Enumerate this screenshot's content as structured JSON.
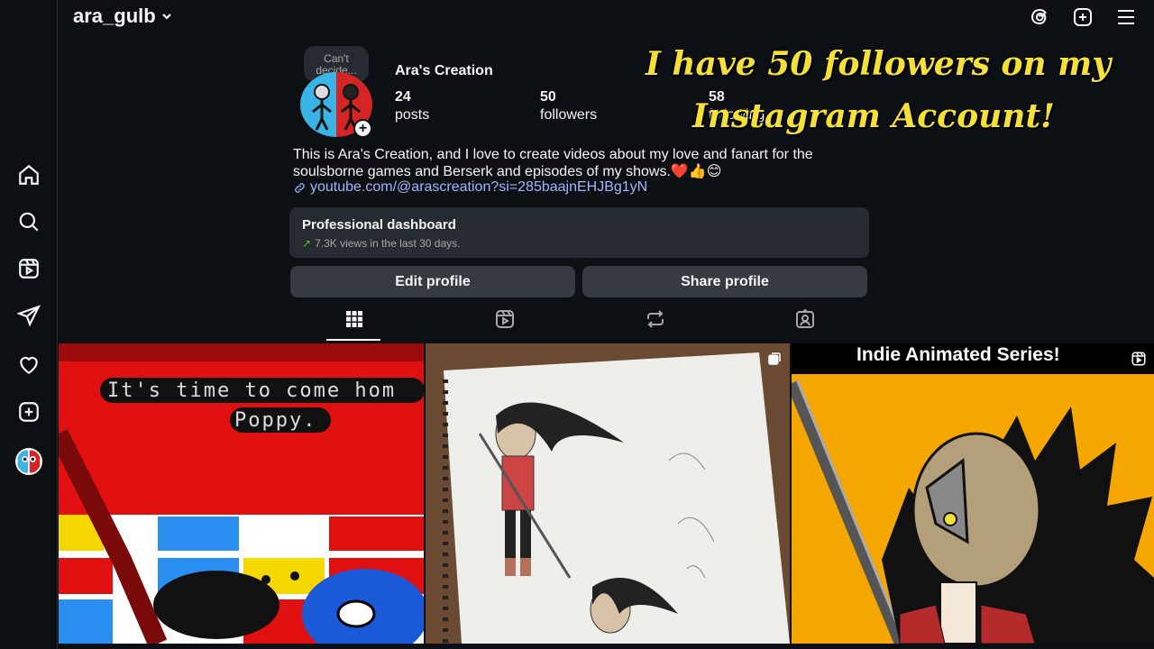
{
  "header": {
    "username": "ara_gulb"
  },
  "profile": {
    "note": "Can't decide...",
    "display_name": "Ara's Creation",
    "stats": [
      {
        "value": "24",
        "label": "posts"
      },
      {
        "value": "50",
        "label": "followers"
      },
      {
        "value": "58",
        "label": "following"
      }
    ],
    "bio_line1": "This is Ara's Creation, and I love to create videos about my love and fanart for the",
    "bio_line2": "soulsborne games and Berserk and episodes of my shows.❤️👍😊",
    "link": "youtube.com/@arascreation?si=285baajnEHJBg1yN"
  },
  "overlay": {
    "line1": "I have 50 followers on my",
    "line2": "Instagram Account!",
    "color": "#f5e03a"
  },
  "dashboard": {
    "title": "Professional dashboard",
    "subtitle": "7.3K views in the last 30 days."
  },
  "buttons": {
    "edit": "Edit profile",
    "share": "Share profile"
  },
  "posts": {
    "p1_line1": "It's time to come hom",
    "p1_line2": "Poppy.",
    "p3_title": "Indie Animated Series!"
  },
  "icons": {
    "sidebar": [
      "home-icon",
      "search-icon",
      "reels-icon",
      "messages-icon",
      "notifications-icon",
      "create-icon",
      "profile-avatar"
    ],
    "top": [
      "threads-icon",
      "new-post-icon",
      "menu-icon"
    ],
    "tabs": [
      "grid-icon",
      "reels-tab-icon",
      "reposts-icon",
      "tagged-icon"
    ]
  }
}
